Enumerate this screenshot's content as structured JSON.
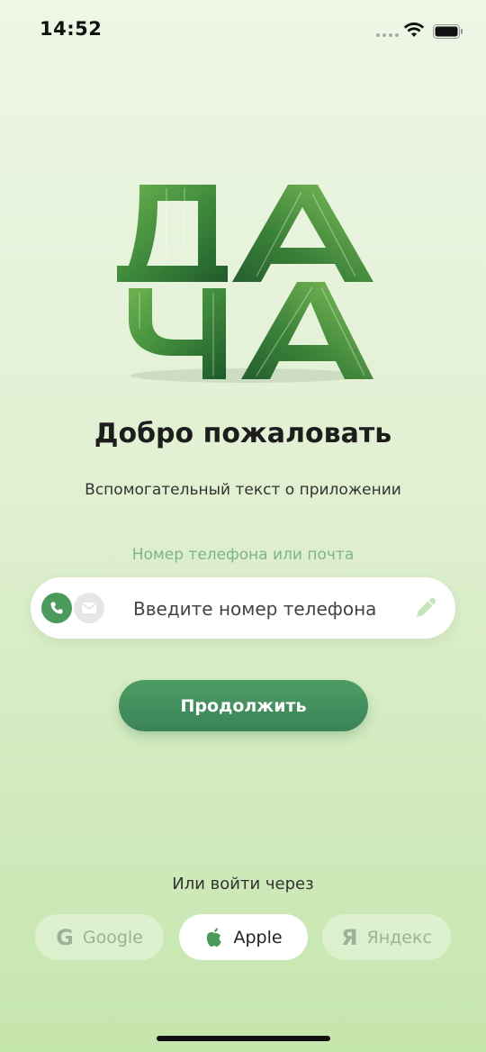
{
  "status_bar": {
    "time": "14:52"
  },
  "logo": {
    "text": "ДАЧА",
    "color": "#3f8a3c"
  },
  "welcome": {
    "title": "Добро пожаловать",
    "subtitle": "Вспомогательный текст о приложении"
  },
  "login": {
    "field_label": "Номер телефона или почта",
    "input_placeholder": "Введите номер телефона",
    "input_value": "",
    "mode_icons": [
      "phone-icon",
      "mail-icon"
    ],
    "continue_label": "Продолжить"
  },
  "social": {
    "label": "Или войти через",
    "providers": [
      {
        "name": "Google",
        "icon": "G"
      },
      {
        "name": "Apple",
        "icon": "apple-icon"
      },
      {
        "name": "Яндекс",
        "icon": "Я"
      }
    ]
  },
  "colors": {
    "accent": "#4a9a5c",
    "label_green": "#7fb389",
    "background_top": "#eef6e6",
    "background_bottom": "#c5e6ad"
  }
}
